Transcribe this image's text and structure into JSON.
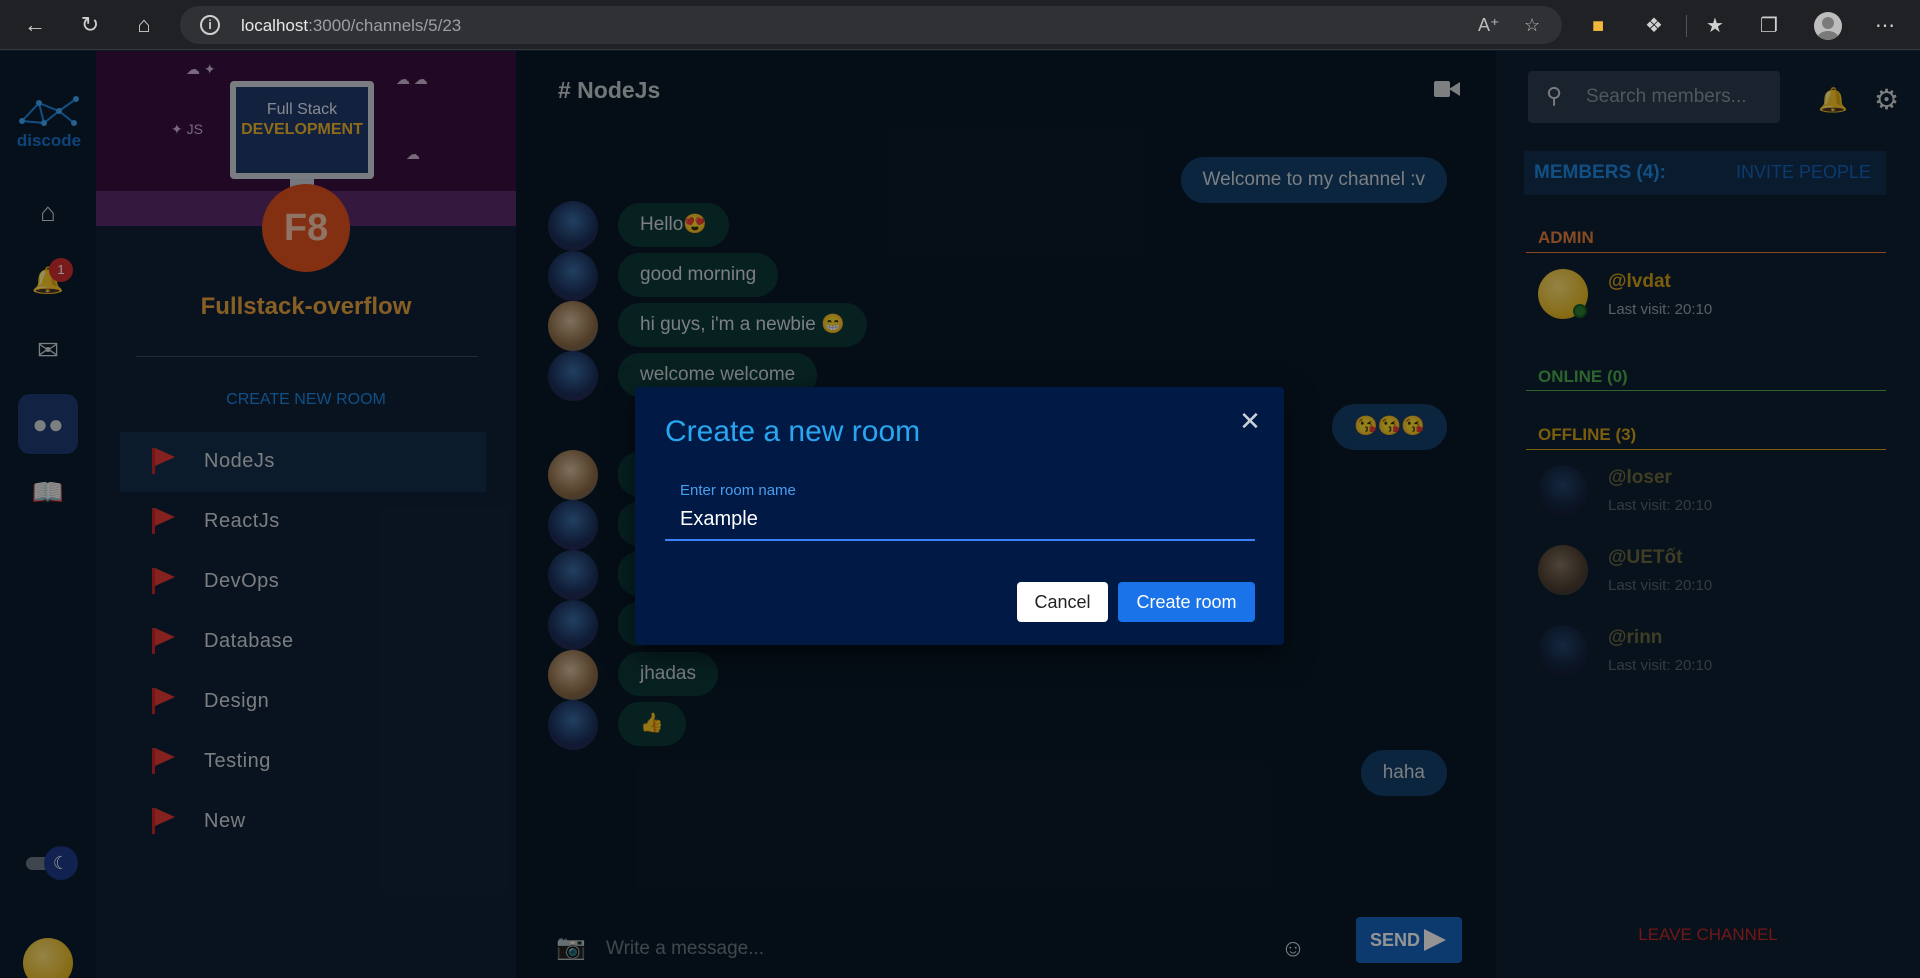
{
  "browser": {
    "url_host": "localhost",
    "url_rest": ":3000/channels/5/23"
  },
  "rail": {
    "logo_text": "discode",
    "notification_count": "1"
  },
  "server": {
    "banner_line1": "Full Stack",
    "banner_line2": "DEVELOPMENT",
    "logo_text": "F8",
    "name": "Fullstack-overflow",
    "create_room_label": "CREATE NEW ROOM",
    "rooms": [
      {
        "label": "NodeJs"
      },
      {
        "label": "ReactJs"
      },
      {
        "label": "DevOps"
      },
      {
        "label": "Database"
      },
      {
        "label": "Design"
      },
      {
        "label": "Testing"
      },
      {
        "label": "New"
      }
    ]
  },
  "chat": {
    "title": "# NodeJs",
    "messages": [
      {
        "text": "Welcome to my channel :v"
      },
      {
        "text": "Hello😍"
      },
      {
        "text": "good morning"
      },
      {
        "text": "hi guys, i'm a newbie 😁"
      },
      {
        "text": "welcome welcome"
      },
      {
        "text": "😘😘😘"
      },
      {
        "text": "jhadas"
      },
      {
        "text": "👍"
      },
      {
        "text": "haha"
      }
    ],
    "composer_placeholder": "Write a message...",
    "send_label": "SEND"
  },
  "members": {
    "search_placeholder": "Search members...",
    "header": "MEMBERS (4):",
    "invite_label": "INVITE PEOPLE",
    "admin_title": "ADMIN",
    "online_title": "ONLINE (0)",
    "offline_title": "OFFLINE (3)",
    "admin": [
      {
        "name": "@lvdat",
        "visit": "Last visit: 20:10"
      }
    ],
    "offline": [
      {
        "name": "@loser",
        "visit": "Last visit: 20:10"
      },
      {
        "name": "@UETốt",
        "visit": "Last visit: 20:10"
      },
      {
        "name": "@rinn",
        "visit": "Last visit: 20:10"
      }
    ],
    "leave_label": "LEAVE CHANNEL"
  },
  "modal": {
    "title": "Create a new room",
    "field_label": "Enter room name",
    "field_value": "Example",
    "cancel_label": "Cancel",
    "create_label": "Create room"
  },
  "colors": {
    "accent": "#1a73e8",
    "server_name": "#e8a33d",
    "admin": "#e8803d",
    "online": "#4caf50",
    "offline": "#d4a017"
  }
}
